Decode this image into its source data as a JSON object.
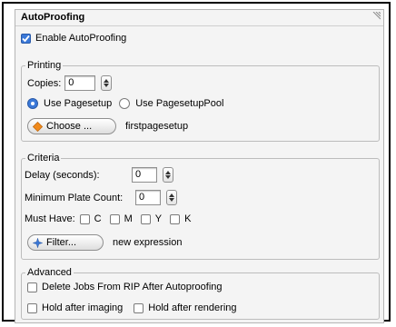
{
  "panel": {
    "title": "AutoProofing"
  },
  "enable_autoproofing": {
    "label": "Enable AutoProofing",
    "checked": true
  },
  "printing": {
    "legend": "Printing",
    "copies_label": "Copies:",
    "copies_value": "0",
    "use_pagesetup_label": "Use Pagesetup",
    "use_pagesetup_pool_label": "Use PagesetupPool",
    "selected": "Use Pagesetup",
    "choose_button_label": "Choose ...",
    "pagesetup_name": "firstpagesetup"
  },
  "criteria": {
    "legend": "Criteria",
    "delay_label": "Delay (seconds):",
    "delay_value": "0",
    "min_plate_label": "Minimum Plate Count:",
    "min_plate_value": "0",
    "must_have_label": "Must Have:",
    "colors": [
      {
        "label": "C",
        "checked": false
      },
      {
        "label": "M",
        "checked": false
      },
      {
        "label": "Y",
        "checked": false
      },
      {
        "label": "K",
        "checked": false
      }
    ],
    "filter_button_label": "Filter...",
    "filter_expression": "new expression"
  },
  "advanced": {
    "legend": "Advanced",
    "delete_jobs_label": "Delete Jobs From RIP After Autoproofing",
    "hold_after_imaging_label": "Hold after imaging",
    "hold_after_rendering_label": "Hold after rendering"
  },
  "colors": {
    "accent": "#3a78d8",
    "choose_icon": "#f08a1c",
    "filter_icon": "#3a78d8"
  }
}
